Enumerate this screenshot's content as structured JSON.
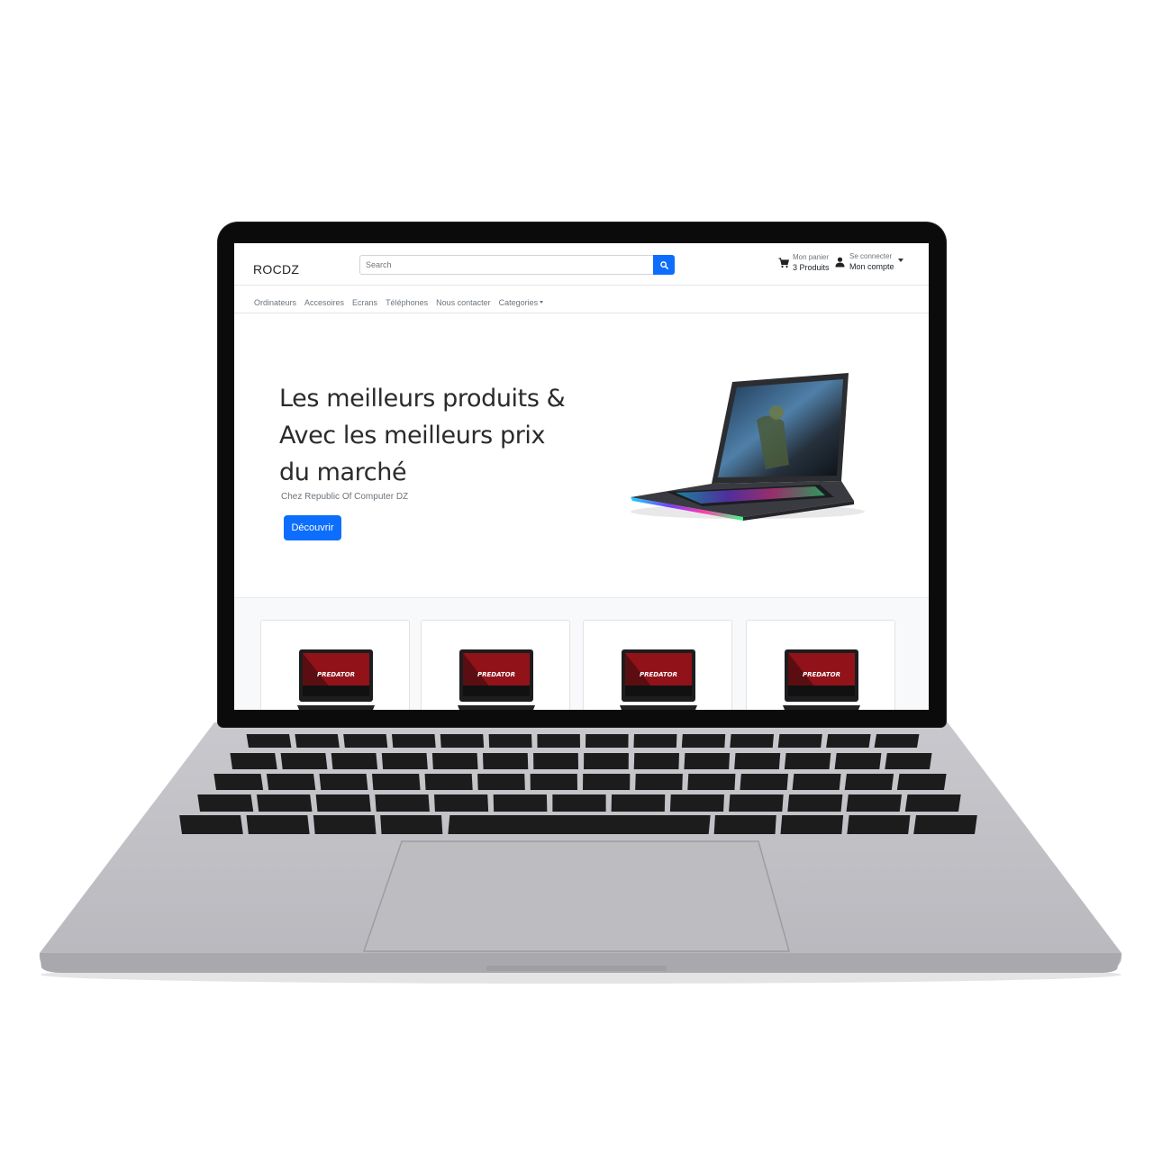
{
  "brand": "ROCDZ",
  "search": {
    "placeholder": "Search"
  },
  "cart": {
    "label": "Mon panier",
    "count_text": "3 Produits"
  },
  "account": {
    "label": "Se connecter",
    "title": "Mon compte"
  },
  "nav": {
    "items": [
      "Ordinateurs",
      "Accesoires",
      "Ecrans",
      "Téléphones",
      "Nous contacter"
    ],
    "dropdown": "Categories"
  },
  "hero": {
    "title_lines": [
      "Les meilleurs produits &",
      "Avec les meilleurs prix",
      "du marché"
    ],
    "subtitle": "Chez Republic Of Computer DZ",
    "cta": "Découvrir"
  },
  "products": [
    {
      "brand_text": "PREDATOR"
    },
    {
      "brand_text": "PREDATOR"
    },
    {
      "brand_text": "PREDATOR"
    },
    {
      "brand_text": "PREDATOR"
    }
  ],
  "colors": {
    "primary": "#0d6efd",
    "laptop_body": "#c0bfc4",
    "bezel": "#0b0b0b",
    "key": "#1c1c1c"
  }
}
